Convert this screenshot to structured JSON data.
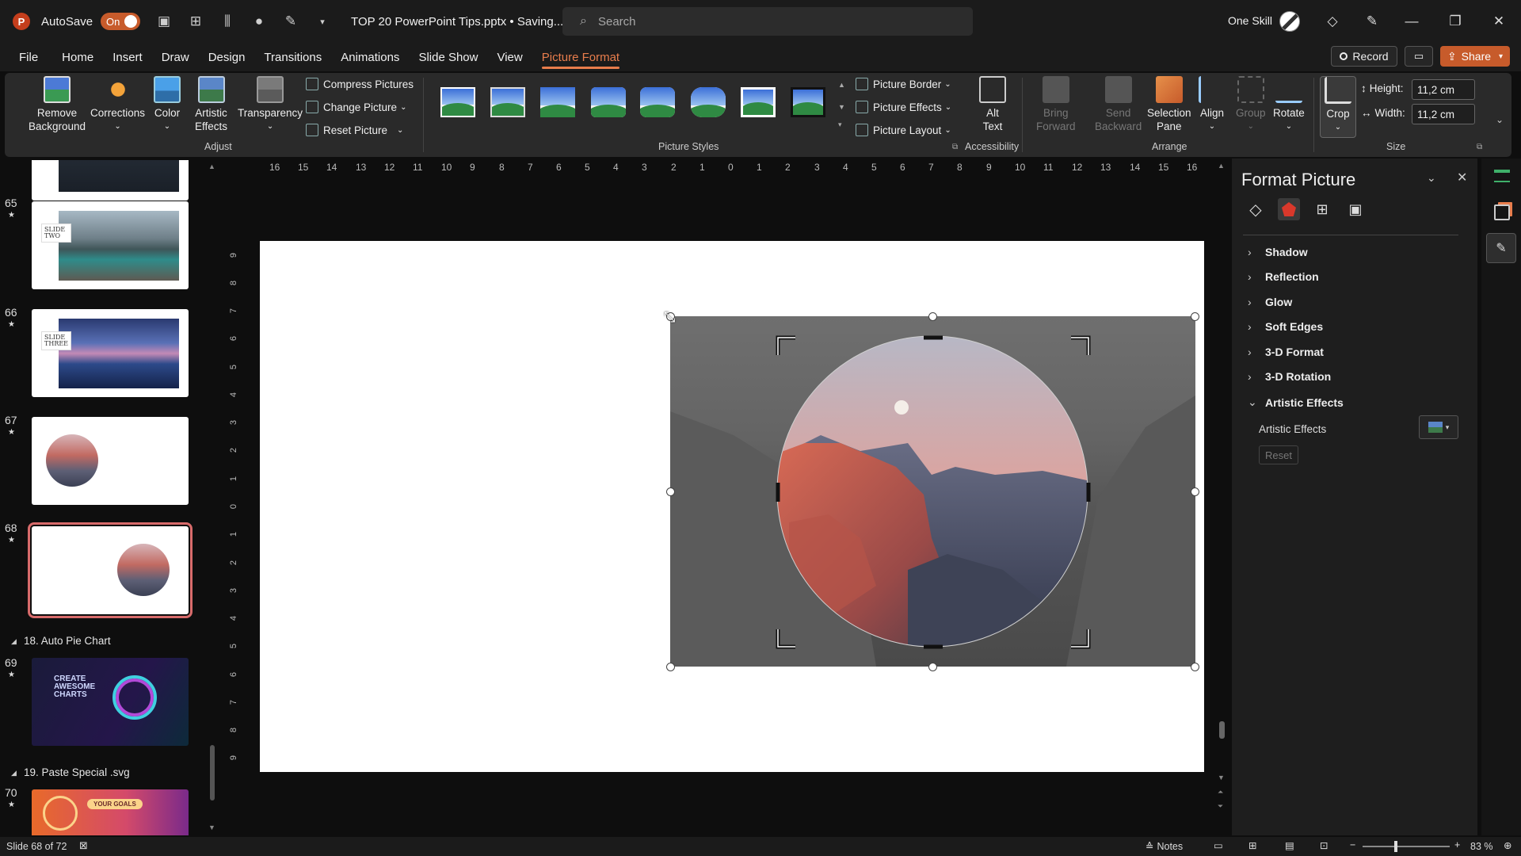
{
  "app": {
    "logo": "P",
    "autosave_label": "AutoSave",
    "autosave_state": "On",
    "doc_title": "TOP 20 PowerPoint Tips.pptx • Saving...",
    "user_name": "One Skill"
  },
  "search": {
    "placeholder": "Search"
  },
  "menu": {
    "tabs": [
      "File",
      "Home",
      "Insert",
      "Draw",
      "Design",
      "Transitions",
      "Animations",
      "Slide Show",
      "View",
      "Picture Format"
    ],
    "active": "Picture Format"
  },
  "actions": {
    "record": "Record",
    "share": "Share"
  },
  "ribbon": {
    "adjust": {
      "remove_background": [
        "Remove",
        "Background"
      ],
      "corrections": "Corrections",
      "color": "Color",
      "artistic_effects": [
        "Artistic",
        "Effects"
      ],
      "transparency": "Transparency",
      "compress": "Compress Pictures",
      "change": "Change Picture",
      "reset": "Reset Picture",
      "label": "Adjust"
    },
    "styles_label": "Picture Styles",
    "border": "Picture Border",
    "effects": "Picture Effects",
    "layout": "Picture Layout",
    "accessibility": {
      "alt_text": [
        "Alt",
        "Text"
      ],
      "label": "Accessibility"
    },
    "arrange": {
      "bring_forward": [
        "Bring",
        "Forward"
      ],
      "send_backward": [
        "Send",
        "Backward"
      ],
      "selection_pane": [
        "Selection",
        "Pane"
      ],
      "align": "Align",
      "group": "Group",
      "rotate": "Rotate",
      "label": "Arrange"
    },
    "size": {
      "crop": "Crop",
      "height_label": "Height:",
      "height_value": "11,2 cm",
      "width_label": "Width:",
      "width_value": "11,2 cm",
      "label": "Size"
    }
  },
  "thumbnails": {
    "slides": [
      {
        "num": "65",
        "word": "SLIDE TWO"
      },
      {
        "num": "66",
        "word": "SLIDE THREE"
      },
      {
        "num": "67"
      },
      {
        "num": "68"
      },
      {
        "num": "69",
        "text": "CREATE AWESOME CHARTS"
      },
      {
        "num": "70",
        "text": "YOUR GOALS"
      }
    ],
    "sections": [
      "18. Auto Pie Chart",
      "19. Paste Special .svg"
    ]
  },
  "ruler": {
    "h": [
      "16",
      "15",
      "14",
      "13",
      "12",
      "11",
      "10",
      "9",
      "8",
      "7",
      "6",
      "5",
      "4",
      "3",
      "2",
      "1",
      "0",
      "1",
      "2",
      "3",
      "4",
      "5",
      "6",
      "7",
      "8",
      "9",
      "10",
      "11",
      "12",
      "13",
      "14",
      "15",
      "16"
    ],
    "v": [
      "9",
      "8",
      "7",
      "6",
      "5",
      "4",
      "3",
      "2",
      "1",
      "0",
      "1",
      "2",
      "3",
      "4",
      "5",
      "6",
      "7",
      "8",
      "9"
    ]
  },
  "format_pane": {
    "title": "Format Picture",
    "sections": [
      "Shadow",
      "Reflection",
      "Glow",
      "Soft Edges",
      "3-D Format",
      "3-D Rotation",
      "Artistic Effects"
    ],
    "artistic_effects_label": "Artistic Effects",
    "reset": "Reset"
  },
  "status": {
    "slide_info": "Slide 68 of 72",
    "notes": "Notes",
    "zoom": "83 %"
  },
  "colors": {
    "accent": "#e87d4c",
    "share": "#c75b2b",
    "selected_thumb": "#d86b6b"
  }
}
